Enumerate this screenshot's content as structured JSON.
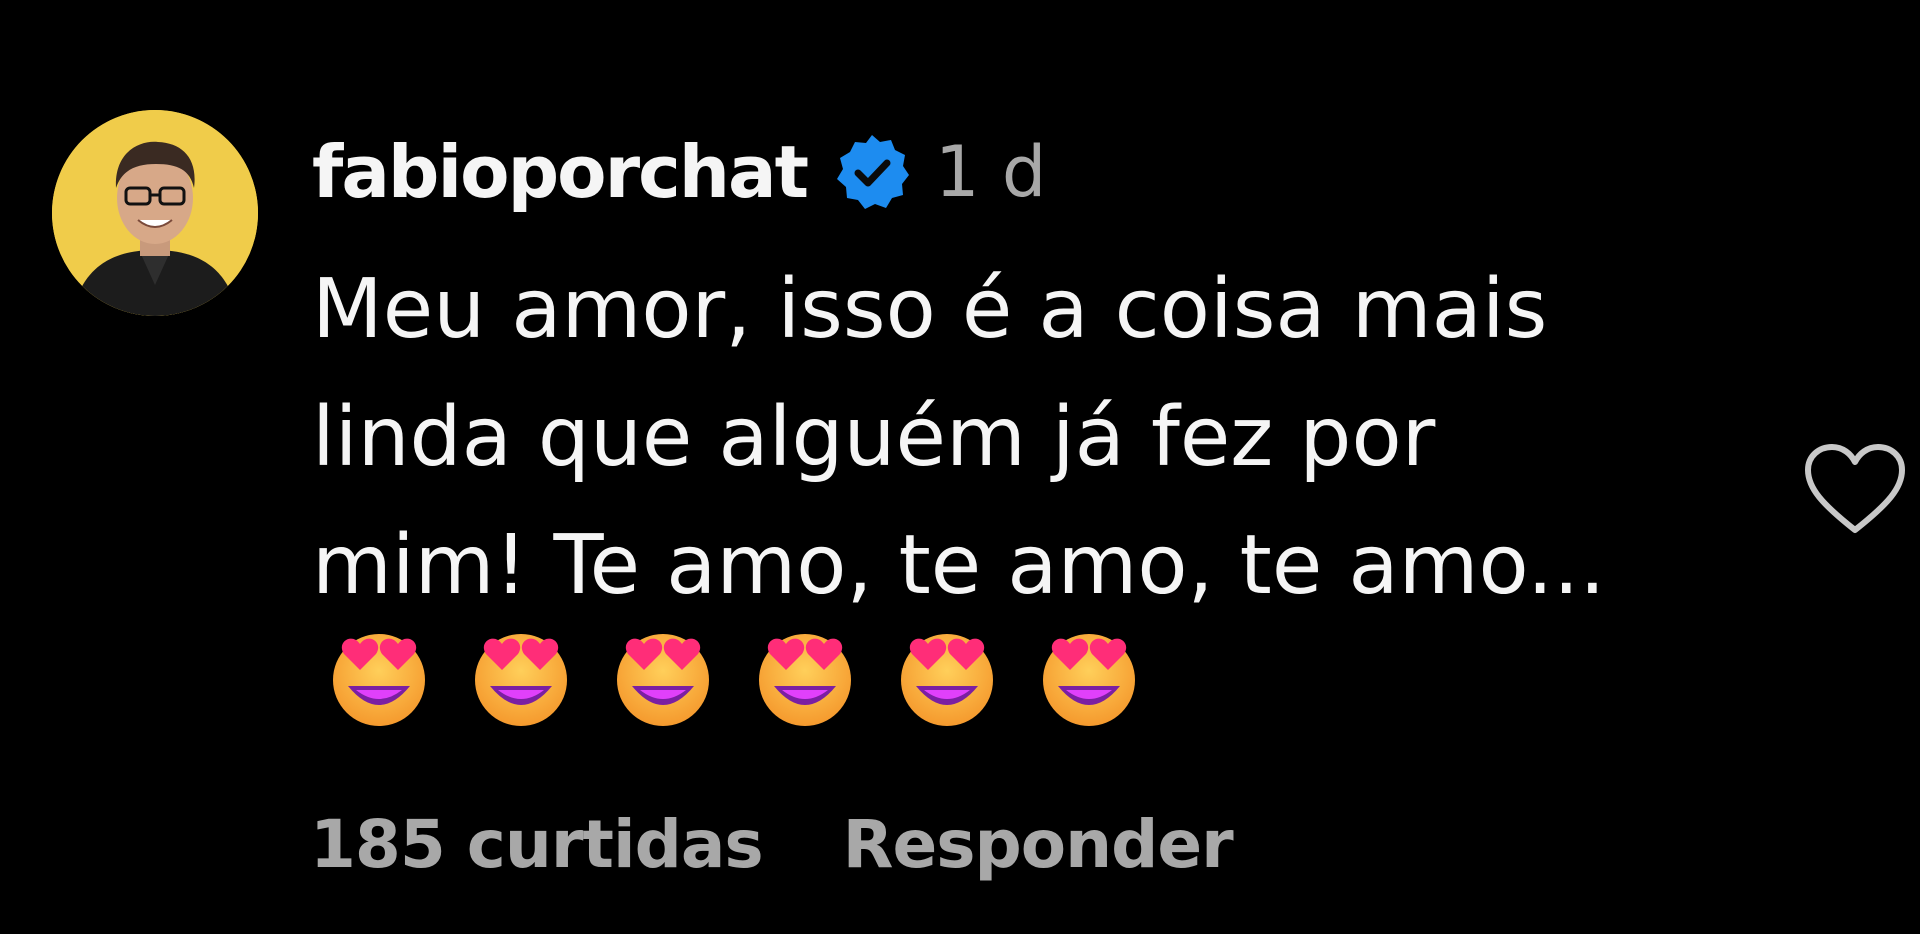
{
  "comment": {
    "username": "fabioporchat",
    "verified": true,
    "verified_icon": "verified-badge-icon",
    "time": "1 d",
    "text": "Meu amor, isso é a coisa mais\nlinda que alguém já fez por\nmim! Te amo, te amo, te amo...",
    "emojis": [
      "heart-eyes-emoji-icon",
      "heart-eyes-emoji-icon",
      "heart-eyes-emoji-icon",
      "heart-eyes-emoji-icon",
      "heart-eyes-emoji-icon",
      "heart-eyes-emoji-icon"
    ],
    "likes_label": "185 curtidas",
    "reply_label": "Responder",
    "like_icon": "heart-outline-icon"
  },
  "colors": {
    "background": "#000000",
    "primary_text": "#f5f5f5",
    "secondary_text": "#a8a8a8",
    "verified_blue": "#1d8cf0",
    "avatar_bg": "#f0cc4a"
  }
}
